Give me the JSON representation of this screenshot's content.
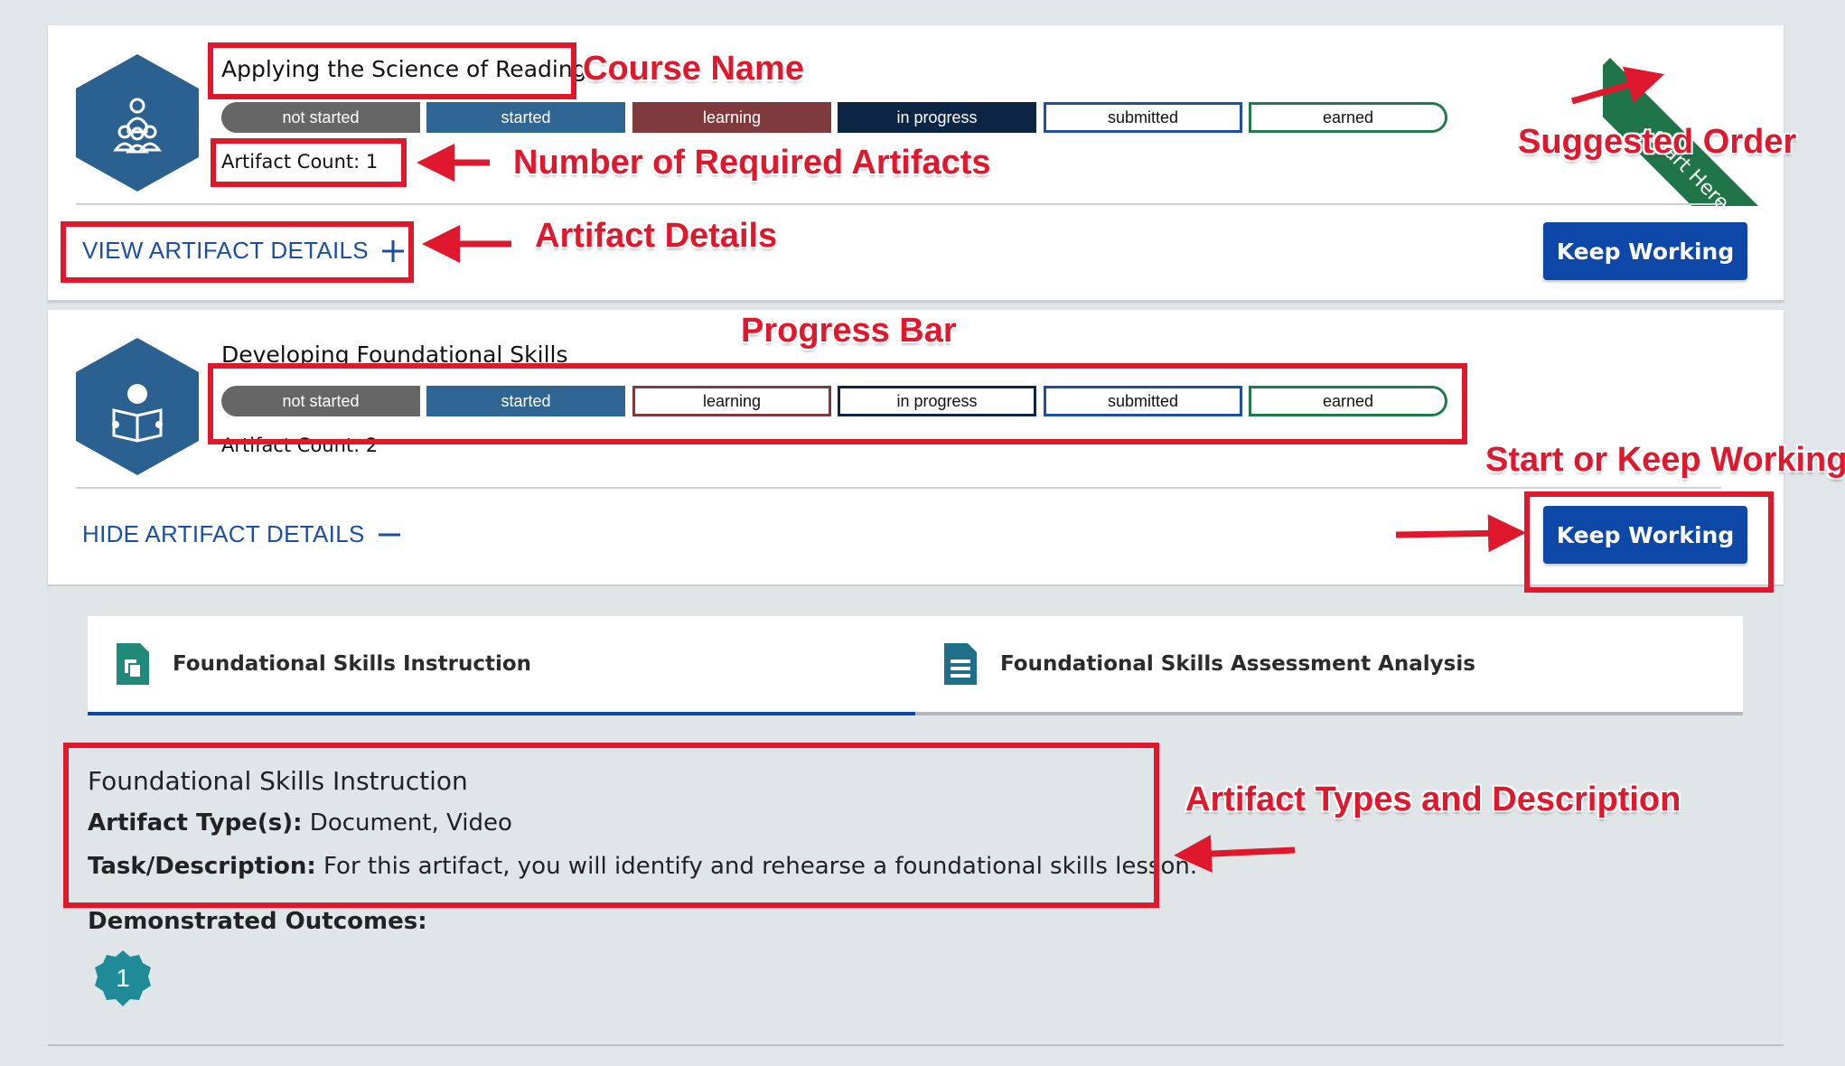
{
  "course1": {
    "title": "Applying the Science of Reading",
    "artifact_count": "Artifact Count: 1",
    "toggle_label": "VIEW ARTIFACT DETAILS",
    "toggle_icon": "plus-icon",
    "button": "Keep Working",
    "ribbon": "Start Here",
    "progress": [
      "not started",
      "started",
      "learning",
      "in progress",
      "submitted",
      "earned"
    ]
  },
  "course2": {
    "title": "Developing Foundational Skills",
    "artifact_count": "Artifact Count: 2",
    "toggle_label": "HIDE ARTIFACT DETAILS",
    "toggle_icon": "minus-icon",
    "button": "Keep Working",
    "progress": [
      "not started",
      "started",
      "learning",
      "in progress",
      "submitted",
      "earned"
    ]
  },
  "tabs": [
    {
      "label": "Foundational Skills Instruction",
      "icon": "documents-icon",
      "active": true
    },
    {
      "label": "Foundational Skills Assessment Analysis",
      "icon": "document-lines-icon",
      "active": false
    }
  ],
  "detail": {
    "title": "Foundational Skills Instruction",
    "type_label": "Artifact Type(s):",
    "type_value": "Document, Video",
    "task_label": "Task/Description:",
    "task_value": "For this artifact, you will identify and rehearse a foundational skills lesson.",
    "outcomes_label": "Demonstrated Outcomes:",
    "outcome_badge": "1"
  },
  "annotations": {
    "course_name": "Course Name",
    "required_artifacts": "Number of Required Artifacts",
    "artifact_details": "Artifact Details",
    "suggested_order": "Suggested Order",
    "progress_bar": "Progress Bar",
    "start_keep": "Start or Keep Working",
    "types_desc": "Artifact Types and Description"
  },
  "colors": {
    "accent_blue": "#0d47a8",
    "hex_blue": "#2b6190",
    "ribbon_green": "#1f7548",
    "annotation_red": "#e0182d",
    "badge_teal": "#1f8a98"
  }
}
